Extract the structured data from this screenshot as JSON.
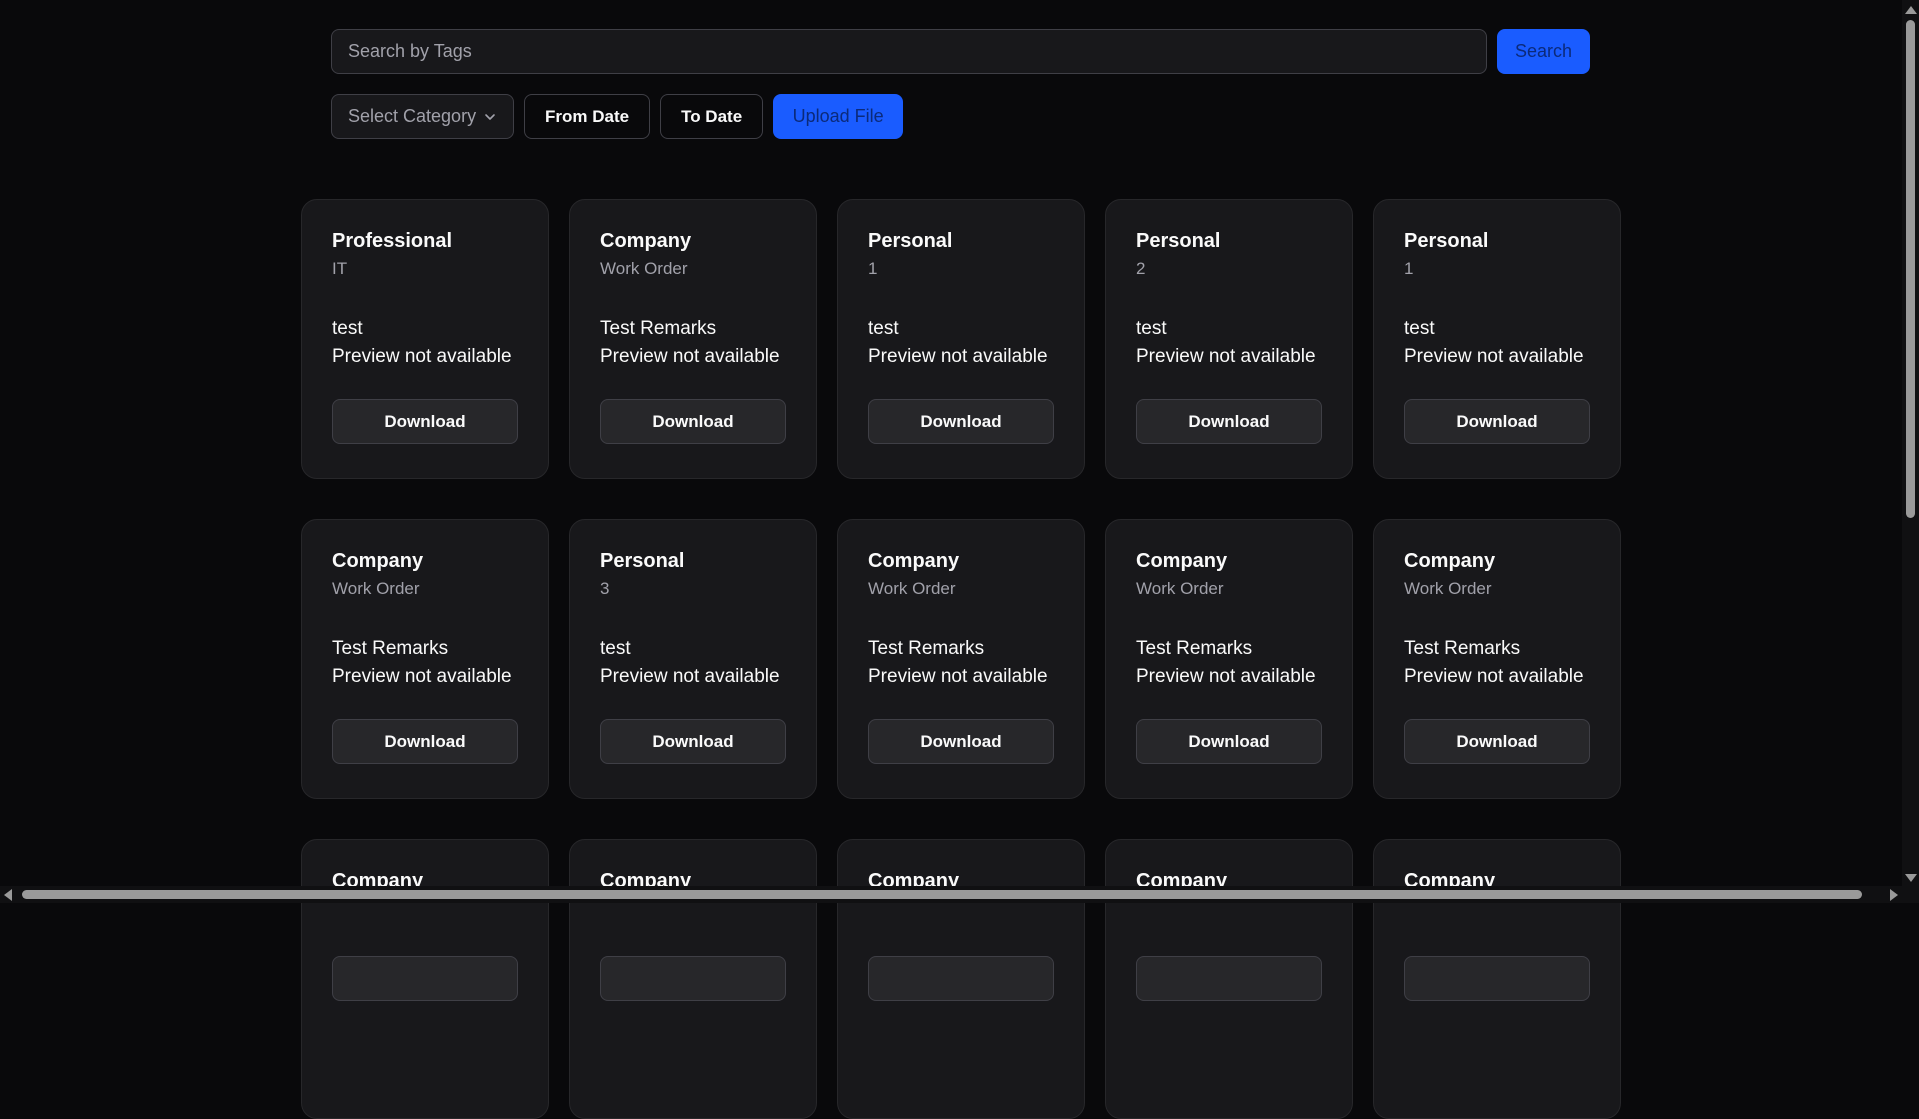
{
  "search": {
    "placeholder": "Search by Tags",
    "button_label": "Search"
  },
  "filters": {
    "category_placeholder": "Select Category",
    "from_date_label": "From Date",
    "to_date_label": "To Date",
    "upload_label": "Upload File"
  },
  "cards": [
    {
      "title": "Professional",
      "subtitle": "IT",
      "remarks": "test",
      "preview": "Preview not available",
      "download": "Download"
    },
    {
      "title": "Company",
      "subtitle": "Work Order",
      "remarks": "Test Remarks",
      "preview": "Preview not available",
      "download": "Download"
    },
    {
      "title": "Personal",
      "subtitle": "1",
      "remarks": "test",
      "preview": "Preview not available",
      "download": "Download"
    },
    {
      "title": "Personal",
      "subtitle": "2",
      "remarks": "test",
      "preview": "Preview not available",
      "download": "Download"
    },
    {
      "title": "Personal",
      "subtitle": "1",
      "remarks": "test",
      "preview": "Preview not available",
      "download": "Download"
    },
    {
      "title": "Company",
      "subtitle": "Work Order",
      "remarks": "Test Remarks",
      "preview": "Preview not available",
      "download": "Download"
    },
    {
      "title": "Personal",
      "subtitle": "3",
      "remarks": "test",
      "preview": "Preview not available",
      "download": "Download"
    },
    {
      "title": "Company",
      "subtitle": "Work Order",
      "remarks": "Test Remarks",
      "preview": "Preview not available",
      "download": "Download"
    },
    {
      "title": "Company",
      "subtitle": "Work Order",
      "remarks": "Test Remarks",
      "preview": "Preview not available",
      "download": "Download"
    },
    {
      "title": "Company",
      "subtitle": "Work Order",
      "remarks": "Test Remarks",
      "preview": "Preview not available",
      "download": "Download"
    },
    {
      "title": "Company",
      "subtitle": "",
      "remarks": "",
      "preview": "",
      "download": ""
    },
    {
      "title": "Company",
      "subtitle": "",
      "remarks": "",
      "preview": "",
      "download": ""
    },
    {
      "title": "Company",
      "subtitle": "",
      "remarks": "",
      "preview": "",
      "download": ""
    },
    {
      "title": "Company",
      "subtitle": "",
      "remarks": "",
      "preview": "",
      "download": ""
    },
    {
      "title": "Company",
      "subtitle": "",
      "remarks": "",
      "preview": "",
      "download": ""
    }
  ],
  "icons": {
    "select_chevron": "chevron-down-icon"
  },
  "colors": {
    "background": "#09090b",
    "card": "#18181b",
    "accent": "#1a5cff"
  }
}
